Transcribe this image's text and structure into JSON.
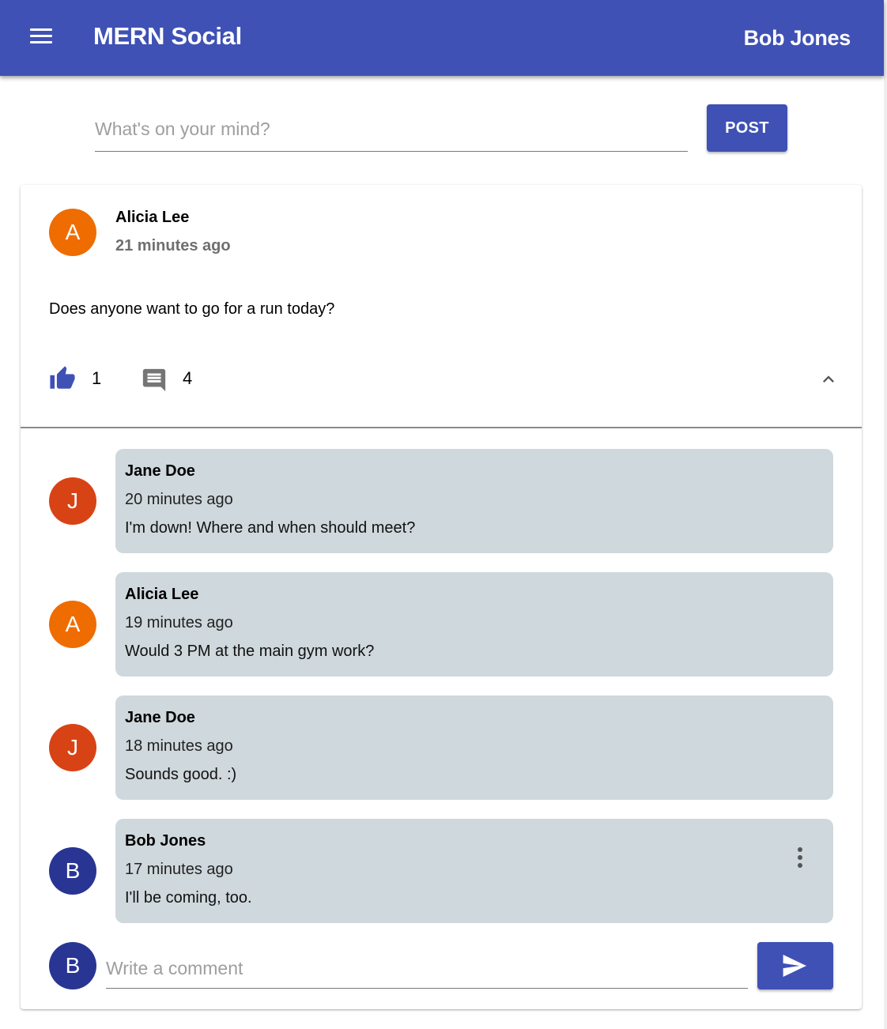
{
  "app": {
    "title": "MERN Social",
    "user": "Bob Jones"
  },
  "composer": {
    "placeholder": "What's on your mind?",
    "post_label": "POST"
  },
  "post": {
    "author": "Alicia Lee",
    "author_initial": "A",
    "time": "21 minutes ago",
    "text": "Does anyone want to go for a run today?",
    "likes": "1",
    "comments_count": "4"
  },
  "comments": [
    {
      "initial": "J",
      "name": "Jane Doe",
      "time": "20 minutes ago",
      "text": "I'm down! Where and when should meet?"
    },
    {
      "initial": "A",
      "name": "Alicia Lee",
      "time": "19 minutes ago",
      "text": "Would 3 PM at the main gym work?"
    },
    {
      "initial": "J",
      "name": "Jane Doe",
      "time": "18 minutes ago",
      "text": "Sounds good. :)"
    },
    {
      "initial": "B",
      "name": "Bob Jones",
      "time": "17 minutes ago",
      "text": "I'll be coming, too."
    }
  ],
  "comment_box": {
    "initial": "B",
    "placeholder": "Write a comment"
  },
  "colors": {
    "primary": "#3f51b5",
    "bubble": "#cfd8dc",
    "avatar_orange": "#ef6c00",
    "avatar_red": "#d84315",
    "avatar_blue": "#283593"
  },
  "icons": [
    "menu-icon",
    "thumb-up-icon",
    "comment-icon",
    "chevron-up-icon",
    "more-vert-icon",
    "send-icon"
  ]
}
